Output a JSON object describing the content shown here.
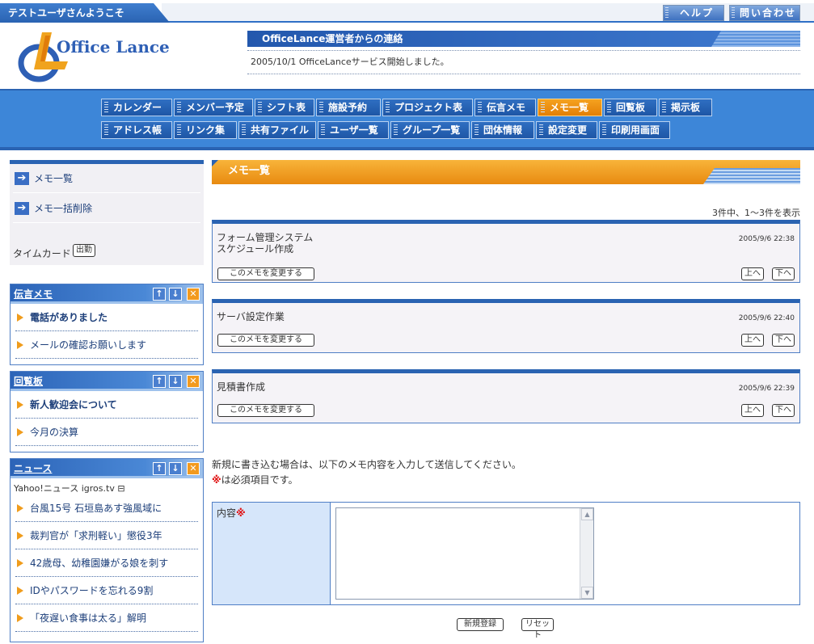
{
  "topbar": {
    "welcome": "テストユーザさんようこそ",
    "help_label": "ヘルプ",
    "contact_label": "問い合わせ"
  },
  "header": {
    "logo_text": "Office Lance",
    "notice_title": "OfficeLance運営者からの連絡",
    "notice_text": "2005/10/1 OfficeLanceサービス開始しました。"
  },
  "nav": {
    "row1": [
      "カレンダー",
      "メンバー予定",
      "シフト表",
      "施設予約",
      "プロジェクト表",
      "伝言メモ",
      "メモ一覧",
      "回覧板",
      "掲示板"
    ],
    "row2": [
      "アドレス帳",
      "リンク集",
      "共有ファイル",
      "ユーザ一覧",
      "グループ一覧",
      "団体情報",
      "設定変更",
      "印刷用画面"
    ],
    "active": "メモ一覧"
  },
  "sidebar": {
    "links": [
      "メモ一覧",
      "メモ一括削除"
    ],
    "timecard_label": "タイムカード",
    "timecard_button": "出勤",
    "panels": [
      {
        "title": "伝言メモ",
        "items": [
          {
            "label": "電話がありました",
            "bold": true
          },
          {
            "label": "メールの確認お願いします",
            "bold": false
          }
        ]
      },
      {
        "title": "回覧板",
        "items": [
          {
            "label": "新人歓迎会について",
            "bold": true
          },
          {
            "label": "今月の決算",
            "bold": false
          }
        ]
      },
      {
        "title": "ニュース",
        "source": "Yahoo!ニュース igros.tv ⊟",
        "items": [
          {
            "label": "台風15号 石垣島あす強風域に",
            "bold": false
          },
          {
            "label": "裁判官が「求刑軽い」懲役3年",
            "bold": false
          },
          {
            "label": "42歳母、幼稚園嫌がる娘を刺す",
            "bold": false
          },
          {
            "label": "IDやパスワードを忘れる9割",
            "bold": false
          },
          {
            "label": "「夜遅い食事は太る」解明",
            "bold": false
          }
        ]
      }
    ],
    "panel_icons": {
      "up": "↑",
      "down": "↓",
      "close": "✕"
    }
  },
  "main": {
    "title": "メモ一覧",
    "count_text": "3件中、1〜3件を表示",
    "memos": [
      {
        "text": "フォーム管理システム\nスケジュール作成",
        "date": "2005/9/6 22:38"
      },
      {
        "text": "サーバ設定作業",
        "date": "2005/9/6 22:40"
      },
      {
        "text": "見積書作成",
        "date": "2005/9/6 22:39"
      }
    ],
    "memo_edit_label": "このメモを変更する",
    "memo_up_label": "上へ",
    "memo_down_label": "下へ",
    "instruction_1": "新規に書き込む場合は、以下のメモ内容を入力して送信してください。",
    "instruction_2_mark": "※",
    "instruction_2": "は必須項目です。",
    "content_label": "内容",
    "content_value": "",
    "submit_label": "新規登録",
    "reset_label": "リセット"
  },
  "colors": {
    "brand_blue": "#2a63b2",
    "accent_orange": "#e88a10",
    "required_red": "#e01010"
  }
}
